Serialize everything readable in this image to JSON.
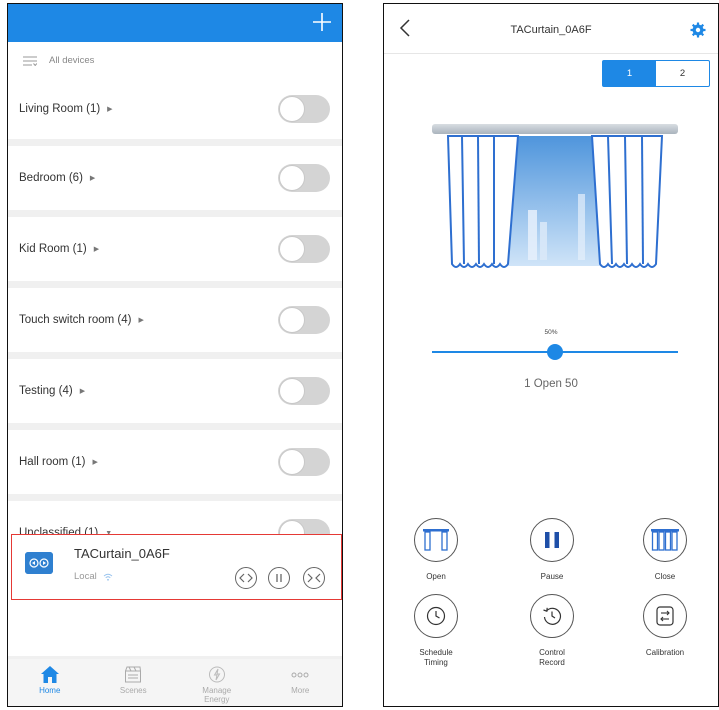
{
  "left": {
    "filter_label": "All devices",
    "rooms": [
      {
        "label": "Living Room (1)",
        "caret": "▶"
      },
      {
        "label": "Bedroom (6)",
        "caret": "▶"
      },
      {
        "label": "Kid Room (1)",
        "caret": "▶"
      },
      {
        "label": "Touch switch room (4)",
        "caret": "▶"
      },
      {
        "label": "Testing (4)",
        "caret": "▶"
      },
      {
        "label": "Hall room (1)",
        "caret": "▶"
      },
      {
        "label": "Unclassified (1)",
        "caret": "▼"
      }
    ],
    "device": {
      "name": "TACurtain_0A6F",
      "status": "Local"
    },
    "tabs": [
      {
        "label": "Home",
        "icon": "home-icon"
      },
      {
        "label": "Scenes",
        "icon": "scenes-icon"
      },
      {
        "label": "Manage\nEnergy",
        "icon": "energy-icon"
      },
      {
        "label": "More",
        "icon": "more-icon"
      }
    ],
    "colors": {
      "accent": "#1e88e5",
      "highlight_border": "#e53935"
    }
  },
  "right": {
    "title": "TACurtain_0A6F",
    "segments": [
      "1",
      "2"
    ],
    "selected_segment": "1",
    "percent_label": "50%",
    "position_percent": 50,
    "state_label": "1 Open 50",
    "actions": [
      {
        "label": "Open",
        "icon": "curtain-open-icon"
      },
      {
        "label": "Pause",
        "icon": "pause-icon"
      },
      {
        "label": "Close",
        "icon": "curtain-close-icon"
      },
      {
        "label": "Schedule\nTiming",
        "icon": "clock-icon"
      },
      {
        "label": "Control\nRecord",
        "icon": "history-icon"
      },
      {
        "label": "Calibration",
        "icon": "calibration-icon"
      }
    ]
  }
}
